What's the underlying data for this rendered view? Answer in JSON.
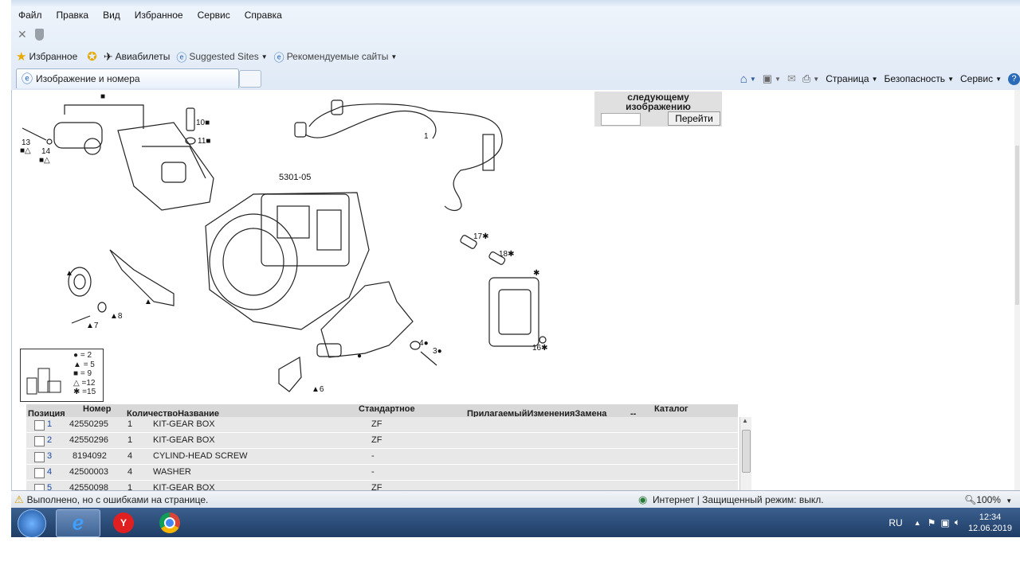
{
  "menu": [
    "Файл",
    "Правка",
    "Вид",
    "Избранное",
    "Сервис",
    "Справка"
  ],
  "favorites": {
    "favorites_label": "Избранное",
    "avia_label": "Авиабилеты",
    "suggested_label": "Suggested Sites",
    "recommended_label": "Рекомендуемые сайты"
  },
  "tab": {
    "title": "Изображение и номера"
  },
  "commands": {
    "page": "Страница",
    "safety": "Безопасность",
    "service": "Сервис"
  },
  "next_panel": {
    "label_line1": "следующему",
    "label_line2": "изображению",
    "go_button": "Перейти"
  },
  "diagram": {
    "title": "5301-05",
    "callouts": [
      "1",
      "6",
      "7",
      "8",
      "10",
      "11",
      "13",
      "14",
      "16",
      "17",
      "18",
      "3",
      "4"
    ],
    "legend": [
      {
        "symbol": "●",
        "value": "= 2"
      },
      {
        "symbol": "▲",
        "value": "= 5"
      },
      {
        "symbol": "■",
        "value": "= 9"
      },
      {
        "symbol": "△",
        "value": "=12"
      },
      {
        "symbol": "✱",
        "value": "=15"
      }
    ]
  },
  "table": {
    "headers": {
      "position": "Позиция",
      "number": "Номер",
      "qty_name": "КоличествоНазвание",
      "standard": "Стандартное",
      "extra": "ПрилагаемыйИзмененияЗамена",
      "dash": "--",
      "catalog": "Каталог"
    },
    "rows": [
      {
        "pos": "1",
        "number": "42550295",
        "qty": "1",
        "name": "KIT-GEAR BOX",
        "std": "ZF"
      },
      {
        "pos": "2",
        "number": "42550296",
        "qty": "1",
        "name": "KIT-GEAR BOX",
        "std": "ZF"
      },
      {
        "pos": "3",
        "number": "8194092",
        "qty": "4",
        "name": "CYLIND-HEAD SCREW",
        "std": "-"
      },
      {
        "pos": "4",
        "number": "42500003",
        "qty": "4",
        "name": "WASHER",
        "std": "-"
      },
      {
        "pos": "5",
        "number": "42550098",
        "qty": "1",
        "name": "KIT-GEAR BOX",
        "std": "ZF"
      }
    ]
  },
  "status": {
    "message": "Выполнено, но с ошибками на странице.",
    "zone": "Интернет | Защищенный режим: выкл.",
    "zoom": "100%"
  },
  "taskbar": {
    "lang": "RU",
    "time": "12:34",
    "date": "12.06.2019"
  }
}
